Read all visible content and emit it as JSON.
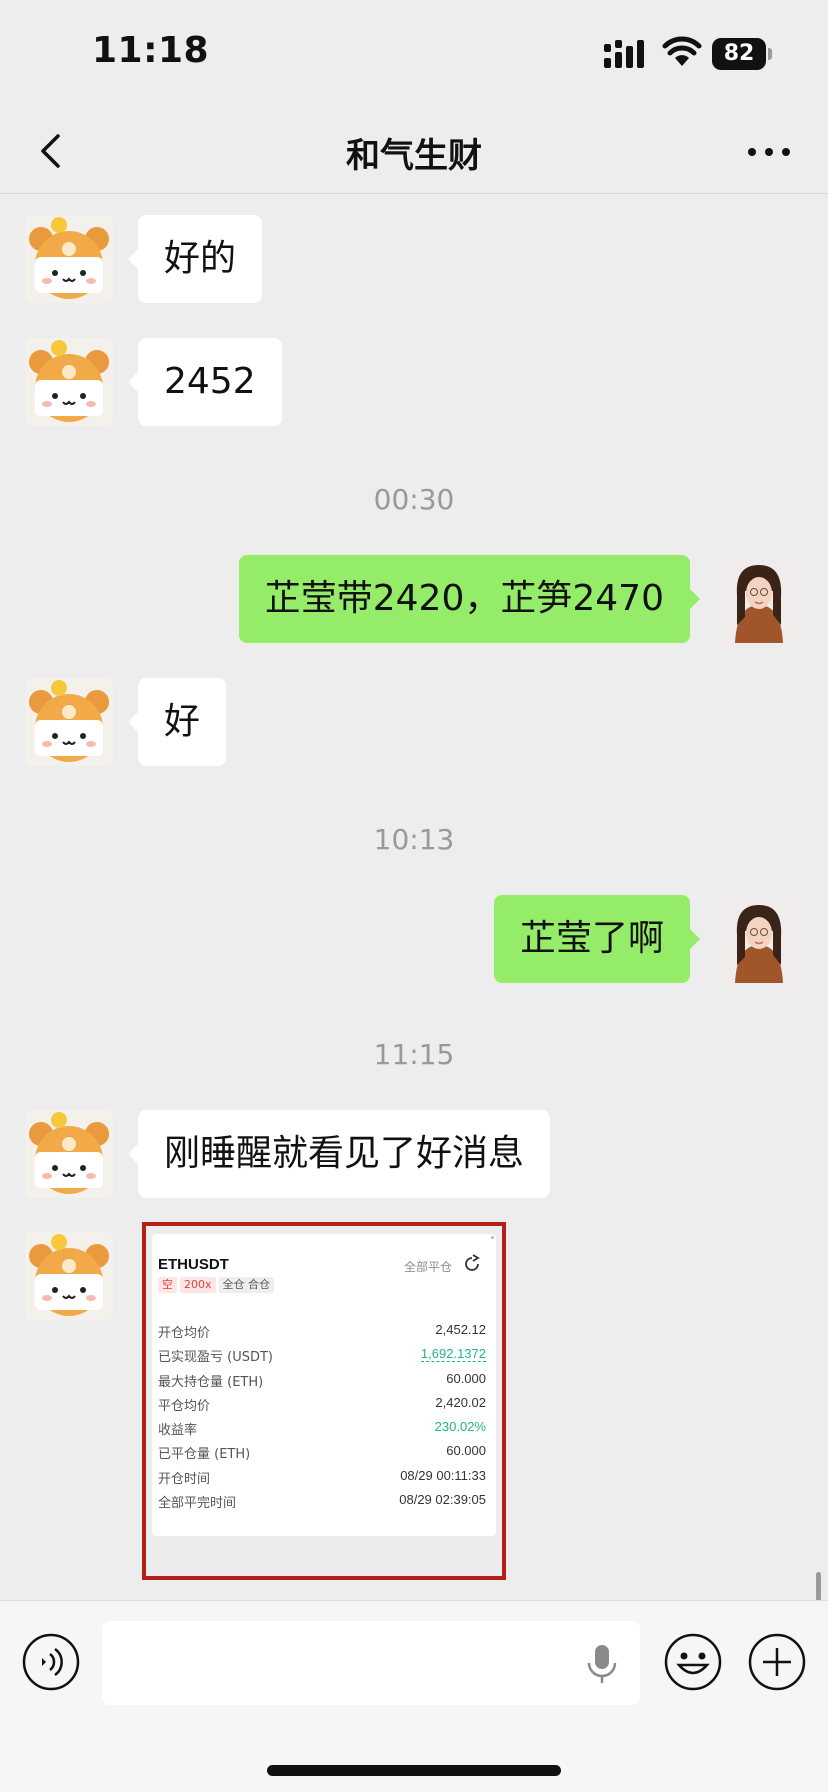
{
  "status_bar": {
    "time": "11:18",
    "battery": "82",
    "icons": [
      "signal-icon",
      "wifi-icon",
      "battery-icon"
    ]
  },
  "nav": {
    "title": "和气生财",
    "icons": [
      "chevron-left-icon",
      "more-dots-icon"
    ]
  },
  "messages": [
    {
      "side": "in",
      "text": "好的"
    },
    {
      "side": "in",
      "text": "2452"
    },
    {
      "type": "time",
      "text": "00:30"
    },
    {
      "side": "out",
      "text": "芷莹带2420，芷笋2470"
    },
    {
      "side": "in",
      "text": "好"
    },
    {
      "type": "time",
      "text": "10:13"
    },
    {
      "side": "out",
      "text": "芷莹了啊"
    },
    {
      "type": "time",
      "text": "11:15"
    },
    {
      "side": "in",
      "text": "刚睡醒就看见了好消息"
    }
  ],
  "trade_card": {
    "symbol": "ETHUSDT",
    "close_all_label": "全部平仓",
    "tags": [
      "空",
      "200x",
      "全仓 合仓"
    ],
    "rows": [
      {
        "label": "开仓均价",
        "value": "2,452.12"
      },
      {
        "label": "已实现盈亏 (USDT)",
        "value": "1,692.1372"
      },
      {
        "label": "最大持仓量 (ETH)",
        "value": "60.000"
      },
      {
        "label": "平仓均价",
        "value": "2,420.02"
      },
      {
        "label": "收益率",
        "value": "230.02%"
      },
      {
        "label": "已平仓量 (ETH)",
        "value": "60.000"
      },
      {
        "label": "开仓时间",
        "value": "08/29 00:11:33"
      },
      {
        "label": "全部平完时间",
        "value": "08/29 02:39:05"
      }
    ],
    "highlight_color": "#23b487",
    "border_color": "#b32017"
  },
  "input_bar": {
    "placeholder": "",
    "icons": [
      "voice-icon",
      "microphone-icon",
      "emoji-icon",
      "plus-icon"
    ]
  },
  "colors": {
    "background": "#ededed",
    "outgoing_bubble": "#95ec69",
    "incoming_bubble": "#ffffff"
  }
}
